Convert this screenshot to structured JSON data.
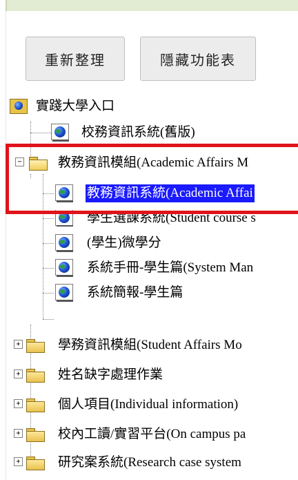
{
  "buttons": {
    "refresh": "重新整理",
    "hide_menu": "隱藏功能表"
  },
  "tree": {
    "root": "實踐大學入口",
    "school_info_old": "校務資訊系統(舊版)",
    "academic_module": "教務資訊模組(Academic Affairs M",
    "academic_children": [
      "教務資訊系統(Academic Affai",
      "學生選課系統(Student course s",
      "(學生)微學分",
      "系統手冊-學生篇(System Man",
      "系統簡報-學生篇"
    ],
    "folders": [
      "學務資訊模組(Student Affairs Mo",
      "姓名缺字處理作業",
      "個人項目(Individual information)",
      "校內工讀/實習平台(On campus pa",
      "研究案系統(Research case system"
    ]
  },
  "colors": {
    "highlight": "#e0131a",
    "selection": "#1a1aff"
  }
}
